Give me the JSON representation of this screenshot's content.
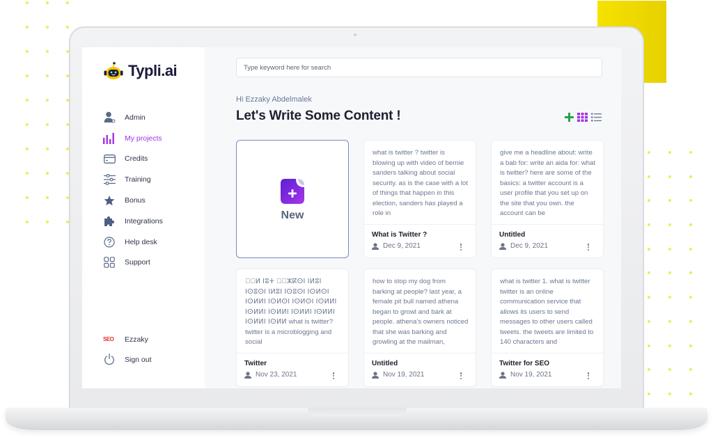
{
  "brand": {
    "name": "Typli.ai",
    "accent": "#a232e0",
    "yellow": "#f6e200"
  },
  "sidebar": {
    "items": [
      {
        "label": "Admin",
        "icon": "admin-user-icon"
      },
      {
        "label": "My projects",
        "icon": "bar-chart-icon",
        "active": true
      },
      {
        "label": "Credits",
        "icon": "credit-card-icon"
      },
      {
        "label": "Training",
        "icon": "sliders-icon"
      },
      {
        "label": "Bonus",
        "icon": "star-icon"
      },
      {
        "label": "Integrations",
        "icon": "puzzle-icon"
      },
      {
        "label": "Help desk",
        "icon": "help-circle-icon"
      },
      {
        "label": "Support",
        "icon": "grid-squares-icon"
      }
    ],
    "user": {
      "badge": "SEO",
      "name": "Ezzaky"
    },
    "signout": {
      "label": "Sign out",
      "icon": "power-icon"
    }
  },
  "search": {
    "placeholder": "Type keyword here for search",
    "value": ""
  },
  "header": {
    "greeting": "Hi Ezzaky Abdelmalek",
    "title": "Let's Write Some Content !",
    "tools": [
      "add-icon",
      "grid-view-icon",
      "list-view-icon"
    ],
    "tool_colors": {
      "add": "#23a447",
      "grid": "#a232e0",
      "list": "#6a7791"
    }
  },
  "new_card": {
    "label": "New"
  },
  "documents": [
    {
      "excerpt": "what is twitter ? twitter is blowing up with video of bernie sanders talking about social security. as is the case with a lot of things that happen in this election, sanders has played a role in",
      "title": "What is Twitter ?",
      "date": "Dec 9, 2021"
    },
    {
      "excerpt": "give me a headline about: write a bab for: write an aida for: what is twitter? here are some of the basics: a twitter account is a user profile that you set up on the site that you own. the account can be",
      "title": "Untitled",
      "date": "Dec 9, 2021"
    },
    {
      "excerpt_script": "ⵓ⵿ⵍ ⵏⵓⵜ ⵙ⵿ⵣⴽⵙⵏ ⵏⵍⵓⵏ ⵏⵙⵓⵙⵏ ⵏⵍⵓⵏ ⵏⵙⵓⵙⵏ ⵏⵙⵍⵙⵏ ⵏⵙⵍⵍⵏ ⵏⵙⵍⵙⵏ ⵏⵙⵍⵙⵏ ⵏⵙⵍⵍⵏ ⵏⵙⵍⵍⵏ ⵏⵙⵍⵍⵏ ⵏⵙⵍⵍⵏ ⵏⵙⵍⵍⵏ ⵏⵙⵍⵍⵏ ⵏⵙⵍⵍ",
      "excerpt": "what is twitter? twitter is a microblogging and social",
      "title": "Twitter",
      "date": "Nov 23, 2021"
    },
    {
      "excerpt": "how to stop my dog from barking at people? last year, a female pit bull named athena began to growl and bark at people. athena's owners noticed that she was barking and growling at the mailman,",
      "title": "Untitled",
      "date": "Nov 19, 2021"
    },
    {
      "excerpt": "what is twitter 1. what is twitter twitter is an online communication service that allows its users to send messages to other users called tweets. the tweets are limited to 140 characters and",
      "title": "Twitter for SEO",
      "date": "Nov 19, 2021"
    }
  ]
}
